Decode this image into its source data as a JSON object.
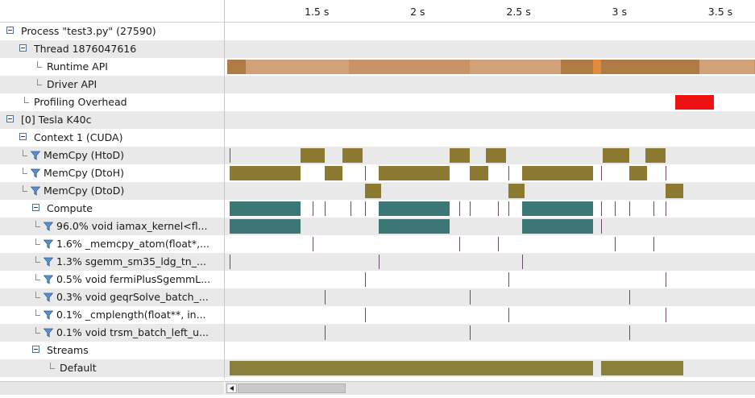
{
  "ruler": {
    "ticks": [
      {
        "label": "1.5 s",
        "t": 1.5
      },
      {
        "label": "2 s",
        "t": 2.0
      },
      {
        "label": "2.5 s",
        "t": 2.5
      },
      {
        "label": "3 s",
        "t": 3.0
      },
      {
        "label": "3.5 s",
        "t": 3.5
      }
    ]
  },
  "colors": {
    "runtime": "#c89366",
    "runtime_dark": "#b07a45",
    "runtime_light": "#d1a27a",
    "runtime_highlight": "#e08a3a",
    "memcpy": "#8c7a32",
    "memcpy_alt": "#978540",
    "kernel": "#3a7775",
    "overhead": "#ee1111",
    "stream": "#8c7f3e",
    "tick": "#6a4a6a"
  },
  "tree": [
    {
      "id": "process",
      "label": "Process \"test3.py\" (27590)",
      "icon": "collapse-icon"
    },
    {
      "id": "thread",
      "label": "Thread 1876047616",
      "icon": "collapse-icon"
    },
    {
      "id": "runtime",
      "label": "Runtime API",
      "icon": "elbow"
    },
    {
      "id": "driver",
      "label": "Driver API",
      "icon": "elbow"
    },
    {
      "id": "overhead",
      "label": "Profiling Overhead",
      "icon": "elbow"
    },
    {
      "id": "device",
      "label": "[0] Tesla K40c",
      "icon": "collapse-icon"
    },
    {
      "id": "context",
      "label": "Context 1 (CUDA)",
      "icon": "collapse-icon"
    },
    {
      "id": "htod",
      "label": "MemCpy (HtoD)",
      "icon": "filter-icon"
    },
    {
      "id": "dtoh",
      "label": "MemCpy (DtoH)",
      "icon": "filter-icon"
    },
    {
      "id": "dtod",
      "label": "MemCpy (DtoD)",
      "icon": "filter-icon"
    },
    {
      "id": "compute",
      "label": "Compute",
      "icon": "collapse-icon"
    },
    {
      "id": "k1",
      "label": "96.0% void iamax_kernel<fl...",
      "icon": "filter-icon"
    },
    {
      "id": "k2",
      "label": "1.6% _memcpy_atom(float*,...",
      "icon": "filter-icon"
    },
    {
      "id": "k3",
      "label": "1.3% sgemm_sm35_ldg_tn_...",
      "icon": "filter-icon"
    },
    {
      "id": "k4",
      "label": "0.5% void fermiPlusSgemmL...",
      "icon": "filter-icon"
    },
    {
      "id": "k5",
      "label": "0.3% void geqrSolve_batch_...",
      "icon": "filter-icon"
    },
    {
      "id": "k6",
      "label": "0.1% _cmplength(float**, in...",
      "icon": "filter-icon"
    },
    {
      "id": "k7",
      "label": "0.1% void trsm_batch_left_u...",
      "icon": "filter-icon"
    },
    {
      "id": "streams",
      "label": "Streams",
      "icon": "collapse-icon"
    },
    {
      "id": "default",
      "label": "Default",
      "icon": "elbow"
    }
  ],
  "timeline": {
    "runtime": {
      "color": "runtime",
      "bars": [
        [
          1.07,
          1.16,
          "runtime_dark"
        ],
        [
          1.16,
          1.67,
          "runtime_light"
        ],
        [
          1.67,
          2.27,
          "runtime"
        ],
        [
          2.27,
          2.72,
          "runtime_light"
        ],
        [
          2.72,
          2.88,
          "runtime_dark"
        ],
        [
          2.88,
          2.92,
          "runtime_highlight"
        ],
        [
          2.92,
          3.41,
          "runtime_dark"
        ],
        [
          3.41,
          3.68,
          "runtime_light"
        ],
        [
          3.68,
          3.76,
          "runtime"
        ]
      ]
    },
    "driver": {
      "bars": []
    },
    "overhead": {
      "bars": [
        [
          3.29,
          3.48,
          "overhead"
        ]
      ]
    },
    "device": {
      "bars": []
    },
    "context": {
      "bars": []
    },
    "htod": {
      "bars": [
        [
          1.43,
          1.55,
          "memcpy"
        ],
        [
          1.64,
          1.74,
          "memcpy"
        ],
        [
          2.17,
          2.27,
          "memcpy"
        ],
        [
          2.35,
          2.45,
          "memcpy"
        ],
        [
          2.93,
          3.06,
          "memcpy"
        ],
        [
          3.14,
          3.24,
          "memcpy"
        ]
      ],
      "ticks": [
        1.08
      ]
    },
    "dtoh": {
      "bars": [
        [
          1.08,
          1.43,
          "memcpy"
        ],
        [
          1.55,
          1.64,
          "memcpy"
        ],
        [
          1.82,
          2.17,
          "memcpy"
        ],
        [
          2.27,
          2.36,
          "memcpy"
        ],
        [
          2.53,
          2.88,
          "memcpy"
        ],
        [
          3.06,
          3.15,
          "memcpy"
        ]
      ],
      "ticks": [
        1.75,
        2.46,
        2.92,
        3.24
      ]
    },
    "dtod": {
      "bars": [
        [
          1.75,
          1.83,
          "memcpy"
        ],
        [
          2.46,
          2.54,
          "memcpy"
        ],
        [
          3.24,
          3.33,
          "memcpy"
        ]
      ]
    },
    "compute": {
      "bars": [
        [
          1.08,
          1.43,
          "kernel"
        ],
        [
          1.82,
          2.17,
          "kernel"
        ],
        [
          2.53,
          2.88,
          "kernel"
        ]
      ],
      "ticks": [
        1.49,
        1.55,
        1.68,
        1.75,
        2.22,
        2.27,
        2.41,
        2.46,
        2.92,
        2.99,
        3.06,
        3.18,
        3.24
      ]
    },
    "k1": {
      "bars": [
        [
          1.08,
          1.43,
          "kernel"
        ],
        [
          1.82,
          2.17,
          "kernel"
        ],
        [
          2.53,
          2.88,
          "kernel"
        ]
      ],
      "ticks": [
        2.92
      ]
    },
    "k2": {
      "bars": [],
      "ticks": [
        1.49,
        2.22,
        2.41,
        2.99,
        3.18
      ]
    },
    "k3": {
      "bars": [],
      "ticks": [
        1.08,
        1.82,
        2.53
      ]
    },
    "k4": {
      "bars": [],
      "ticks": [
        1.75,
        2.46,
        3.24
      ]
    },
    "k5": {
      "bars": [],
      "ticks": [
        1.55,
        2.27,
        3.06
      ]
    },
    "k6": {
      "bars": [],
      "ticks": [
        1.75,
        2.46,
        3.24
      ]
    },
    "k7": {
      "bars": [],
      "ticks": [
        1.55,
        2.27,
        3.06
      ]
    },
    "streams": {
      "bars": []
    },
    "default": {
      "bars": [
        [
          1.08,
          2.88,
          "stream"
        ],
        [
          2.92,
          3.33,
          "stream"
        ]
      ]
    }
  }
}
